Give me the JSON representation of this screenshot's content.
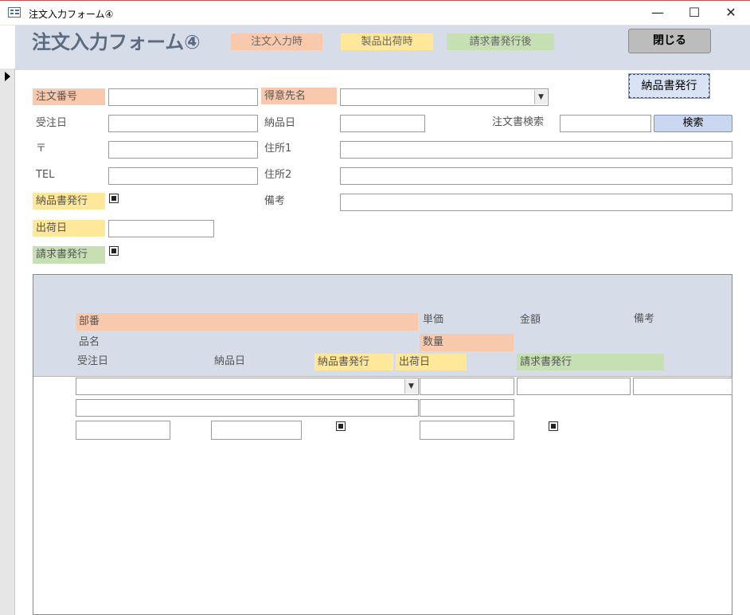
{
  "window": {
    "title": "注文入力フォーム④",
    "minimize_glyph": "—",
    "maximize_glyph": "☐",
    "close_glyph": "✕"
  },
  "header": {
    "form_title": "注文入力フォーム④",
    "legend": {
      "order_entry": "注文入力時",
      "shipping": "製品出荷時",
      "invoice": "請求書発行後"
    },
    "close_button": "閉じる",
    "delivery_issue_button": "納品書発行"
  },
  "form": {
    "order_no_label": "注文番号",
    "order_no_value": "",
    "customer_label": "得意先名",
    "customer_value": "",
    "received_date_label": "受注日",
    "received_date_value": "",
    "delivery_date_label": "納品日",
    "delivery_date_value": "",
    "order_search_label": "注文書検索",
    "order_search_value": "",
    "search_button": "検索",
    "postal_label": "〒",
    "postal_value": "",
    "address1_label": "住所1",
    "address1_value": "",
    "tel_label": "TEL",
    "tel_value": "",
    "address2_label": "住所2",
    "address2_value": "",
    "delivery_note_label": "納品書発行",
    "delivery_note_checked": true,
    "remarks_label": "備考",
    "remarks_value": "",
    "ship_date_label": "出荷日",
    "ship_date_value": "",
    "invoice_label": "請求書発行",
    "invoice_checked": true
  },
  "subform": {
    "headers": {
      "part_no": "部番",
      "unit_price": "単価",
      "amount": "金額",
      "remarks": "備考",
      "product_name": "品名",
      "quantity": "数量",
      "received_date": "受注日",
      "delivery_date": "納品日",
      "delivery_note": "納品書発行",
      "ship_date": "出荷日",
      "invoice": "請求書発行"
    },
    "row": {
      "part_no": "",
      "unit_price": "",
      "amount": "",
      "remarks": "",
      "product_name": "",
      "quantity": "",
      "received_date": "",
      "delivery_date": "",
      "delivery_note_checked": true,
      "ship_date": "",
      "invoice_checked": true
    }
  },
  "colors": {
    "order_entry": "#f8c9ad",
    "shipping": "#ffe89a",
    "invoice": "#c6e0b4",
    "header_band": "#d6dde8"
  },
  "icons": {
    "app_icon": "form-icon",
    "combo_arrow": "chevron-down-icon",
    "record_selector": "record-pointer-icon"
  }
}
